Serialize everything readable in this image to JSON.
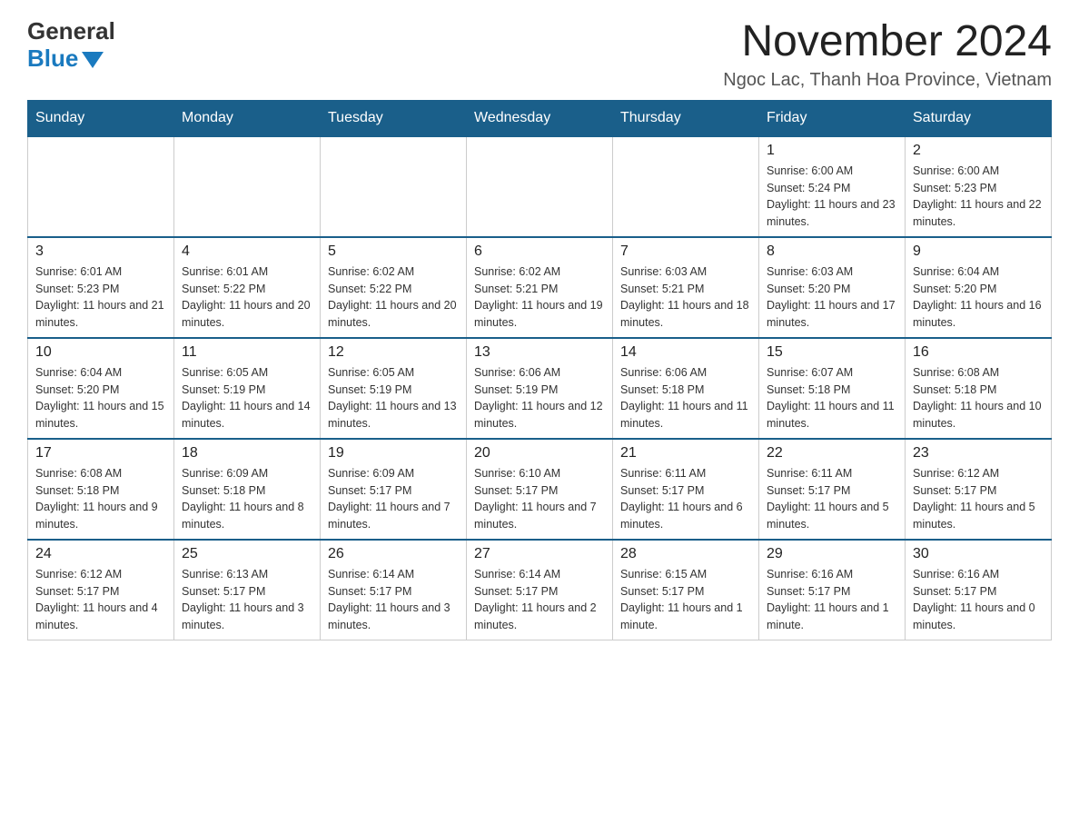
{
  "logo": {
    "general": "General",
    "blue": "Blue"
  },
  "title": "November 2024",
  "location": "Ngoc Lac, Thanh Hoa Province, Vietnam",
  "days_of_week": [
    "Sunday",
    "Monday",
    "Tuesday",
    "Wednesday",
    "Thursday",
    "Friday",
    "Saturday"
  ],
  "weeks": [
    [
      {
        "day": "",
        "info": "",
        "empty": true
      },
      {
        "day": "",
        "info": "",
        "empty": true
      },
      {
        "day": "",
        "info": "",
        "empty": true
      },
      {
        "day": "",
        "info": "",
        "empty": true
      },
      {
        "day": "",
        "info": "",
        "empty": true
      },
      {
        "day": "1",
        "info": "Sunrise: 6:00 AM\nSunset: 5:24 PM\nDaylight: 11 hours and 23 minutes."
      },
      {
        "day": "2",
        "info": "Sunrise: 6:00 AM\nSunset: 5:23 PM\nDaylight: 11 hours and 22 minutes."
      }
    ],
    [
      {
        "day": "3",
        "info": "Sunrise: 6:01 AM\nSunset: 5:23 PM\nDaylight: 11 hours and 21 minutes."
      },
      {
        "day": "4",
        "info": "Sunrise: 6:01 AM\nSunset: 5:22 PM\nDaylight: 11 hours and 20 minutes."
      },
      {
        "day": "5",
        "info": "Sunrise: 6:02 AM\nSunset: 5:22 PM\nDaylight: 11 hours and 20 minutes."
      },
      {
        "day": "6",
        "info": "Sunrise: 6:02 AM\nSunset: 5:21 PM\nDaylight: 11 hours and 19 minutes."
      },
      {
        "day": "7",
        "info": "Sunrise: 6:03 AM\nSunset: 5:21 PM\nDaylight: 11 hours and 18 minutes."
      },
      {
        "day": "8",
        "info": "Sunrise: 6:03 AM\nSunset: 5:20 PM\nDaylight: 11 hours and 17 minutes."
      },
      {
        "day": "9",
        "info": "Sunrise: 6:04 AM\nSunset: 5:20 PM\nDaylight: 11 hours and 16 minutes."
      }
    ],
    [
      {
        "day": "10",
        "info": "Sunrise: 6:04 AM\nSunset: 5:20 PM\nDaylight: 11 hours and 15 minutes."
      },
      {
        "day": "11",
        "info": "Sunrise: 6:05 AM\nSunset: 5:19 PM\nDaylight: 11 hours and 14 minutes."
      },
      {
        "day": "12",
        "info": "Sunrise: 6:05 AM\nSunset: 5:19 PM\nDaylight: 11 hours and 13 minutes."
      },
      {
        "day": "13",
        "info": "Sunrise: 6:06 AM\nSunset: 5:19 PM\nDaylight: 11 hours and 12 minutes."
      },
      {
        "day": "14",
        "info": "Sunrise: 6:06 AM\nSunset: 5:18 PM\nDaylight: 11 hours and 11 minutes."
      },
      {
        "day": "15",
        "info": "Sunrise: 6:07 AM\nSunset: 5:18 PM\nDaylight: 11 hours and 11 minutes."
      },
      {
        "day": "16",
        "info": "Sunrise: 6:08 AM\nSunset: 5:18 PM\nDaylight: 11 hours and 10 minutes."
      }
    ],
    [
      {
        "day": "17",
        "info": "Sunrise: 6:08 AM\nSunset: 5:18 PM\nDaylight: 11 hours and 9 minutes."
      },
      {
        "day": "18",
        "info": "Sunrise: 6:09 AM\nSunset: 5:18 PM\nDaylight: 11 hours and 8 minutes."
      },
      {
        "day": "19",
        "info": "Sunrise: 6:09 AM\nSunset: 5:17 PM\nDaylight: 11 hours and 7 minutes."
      },
      {
        "day": "20",
        "info": "Sunrise: 6:10 AM\nSunset: 5:17 PM\nDaylight: 11 hours and 7 minutes."
      },
      {
        "day": "21",
        "info": "Sunrise: 6:11 AM\nSunset: 5:17 PM\nDaylight: 11 hours and 6 minutes."
      },
      {
        "day": "22",
        "info": "Sunrise: 6:11 AM\nSunset: 5:17 PM\nDaylight: 11 hours and 5 minutes."
      },
      {
        "day": "23",
        "info": "Sunrise: 6:12 AM\nSunset: 5:17 PM\nDaylight: 11 hours and 5 minutes."
      }
    ],
    [
      {
        "day": "24",
        "info": "Sunrise: 6:12 AM\nSunset: 5:17 PM\nDaylight: 11 hours and 4 minutes."
      },
      {
        "day": "25",
        "info": "Sunrise: 6:13 AM\nSunset: 5:17 PM\nDaylight: 11 hours and 3 minutes."
      },
      {
        "day": "26",
        "info": "Sunrise: 6:14 AM\nSunset: 5:17 PM\nDaylight: 11 hours and 3 minutes."
      },
      {
        "day": "27",
        "info": "Sunrise: 6:14 AM\nSunset: 5:17 PM\nDaylight: 11 hours and 2 minutes."
      },
      {
        "day": "28",
        "info": "Sunrise: 6:15 AM\nSunset: 5:17 PM\nDaylight: 11 hours and 1 minute."
      },
      {
        "day": "29",
        "info": "Sunrise: 6:16 AM\nSunset: 5:17 PM\nDaylight: 11 hours and 1 minute."
      },
      {
        "day": "30",
        "info": "Sunrise: 6:16 AM\nSunset: 5:17 PM\nDaylight: 11 hours and 0 minutes."
      }
    ]
  ]
}
